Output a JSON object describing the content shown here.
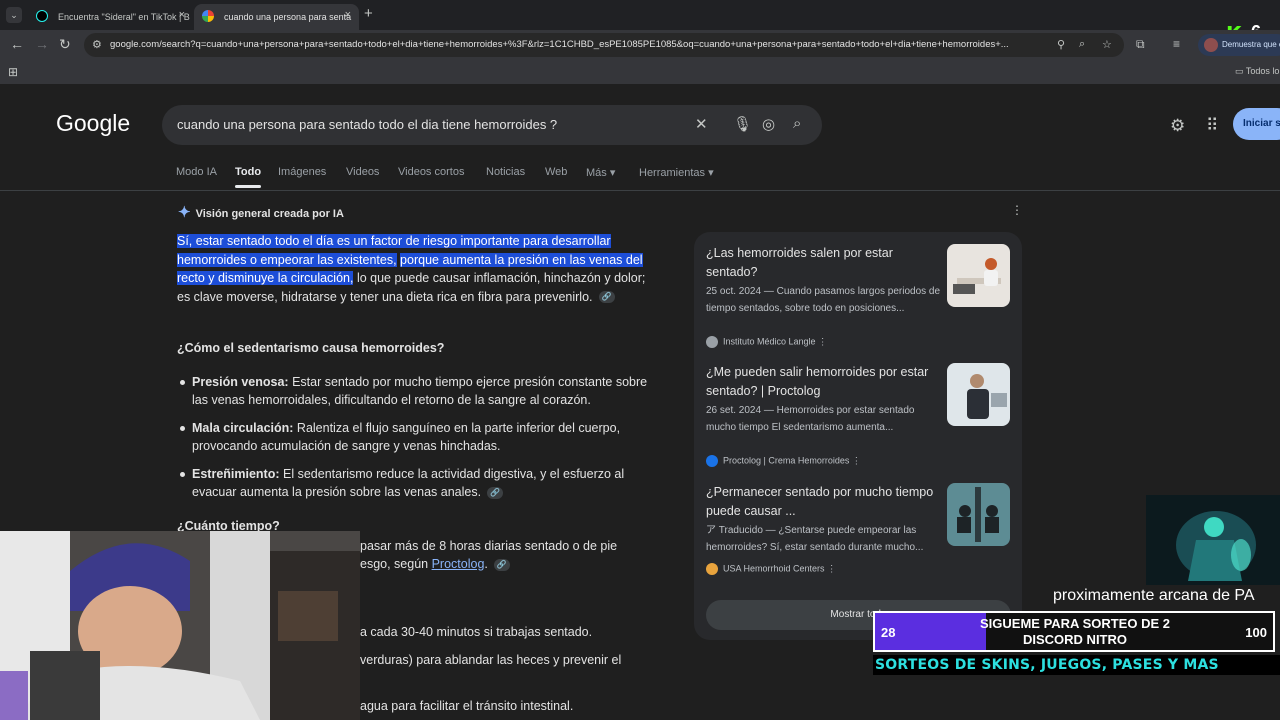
{
  "tabs": [
    {
      "title": "Encuentra \"Sideral\" en TikTok | B",
      "close": "×"
    },
    {
      "title": "cuando una persona para senta",
      "close": "×"
    }
  ],
  "tab_list_icon": "chevron-down",
  "new_tab_label": "+",
  "address_bar": {
    "url": "google.com/search?q=cuando+una+persona+para+sentado+todo+el+dia+tiene+hemorroides+%3F&rlz=1C1CHBD_esPE1085PE1085&oq=cuando+una+persona+para+sentado+todo+el+dia+tiene+hemorroides+...",
    "profile_label": "Demuestra que er"
  },
  "bookmarks": {
    "all_label": "Todos lo"
  },
  "kick": {
    "logo": "K",
    "count": "6"
  },
  "google": {
    "logo": "Google",
    "query": "cuando una persona para sentado todo el dia tiene hemorroides ?",
    "signin": "Iniciar s",
    "nav": [
      "Modo IA",
      "Todo",
      "Imágenes",
      "Videos",
      "Videos cortos",
      "Noticias",
      "Web",
      "Más ▾",
      "Herramientas ▾"
    ]
  },
  "ai": {
    "heading": "Visión general creada por IA",
    "menu": "⋮",
    "p1_hl1": "Sí, estar sentado todo el día es un factor de riesgo importante para desarrollar hemorroides o empeorar las existentes,",
    "p1_hl2": "porque aumenta la presión en las venas del recto y disminuye la circulación,",
    "p1_rest": "lo que puede causar inflamación, hinchazón y dolor; es clave moverse, hidratarse y tener una dieta rica en fibra para prevenirlo.",
    "h_como": "¿Cómo el sedentarismo causa hemorroides?",
    "bullets": [
      {
        "bold": "Presión venosa:",
        "text": "Estar sentado por mucho tiempo ejerce presión constante sobre las venas hemorroidales, dificultando el retorno de la sangre al corazón."
      },
      {
        "bold": "Mala circulación:",
        "text": "Ralentiza el flujo sanguíneo en la parte inferior del cuerpo, provocando acumulación de sangre y venas hinchadas."
      },
      {
        "bold": "Estreñimiento:",
        "text": "El sedentarismo reduce la actividad digestiva, y el esfuerzo al evacuar aumenta la presión sobre las venas anales."
      }
    ],
    "h_cuanto": "¿Cuánto tiempo?",
    "cuanto_1": "pasar más de 8 horas diarias sentado o de pie",
    "cuanto_2": "esgo, según",
    "cuanto_link": "Proctolog",
    "cuanto_end": ".",
    "tip_1": "a cada 30-40 minutos si trabajas sentado.",
    "tip_2": "verduras) para ablandar las heces y prevenir el",
    "tip_3": "agua para facilitar el tránsito intestinal."
  },
  "sources": [
    {
      "title": "¿Las hemorroides salen por estar sentado?",
      "snippet": "25 oct. 2024 — Cuando pasamos largos periodos de tiempo sentados, sobre todo en posiciones...",
      "site": "Instituto Médico Langle",
      "color": "#5f6368"
    },
    {
      "title": "¿Me pueden salir hemorroides por estar sentado? | Proctolog",
      "snippet": "26 set. 2024 — Hemorroides por estar sentado mucho tiempo El sedentarismo aumenta...",
      "site": "Proctolog | Crema Hemorroides",
      "color": "#1a73e8"
    },
    {
      "title": "¿Permanecer sentado por mucho tiempo puede causar ...",
      "snippet": "Traducido — ¿Sentarse puede empeorar las hemorroides? Sí, estar sentado durante mucho...",
      "site": "USA Hemorrhoid Centers",
      "color": "#e8a33d"
    }
  ],
  "show_more": "Mostrar todo",
  "stream": {
    "arcana": "proximamente arcana de PA",
    "goal_current": "28",
    "goal_target": "100",
    "goal_progress": 0.28,
    "goal_line1": "SIGUEME PARA SORTEO DE 2",
    "goal_line2": "DISCORD NITRO",
    "sorteos": "SORTEOS DE SKINS, JUEGOS, PASES Y MAS"
  }
}
